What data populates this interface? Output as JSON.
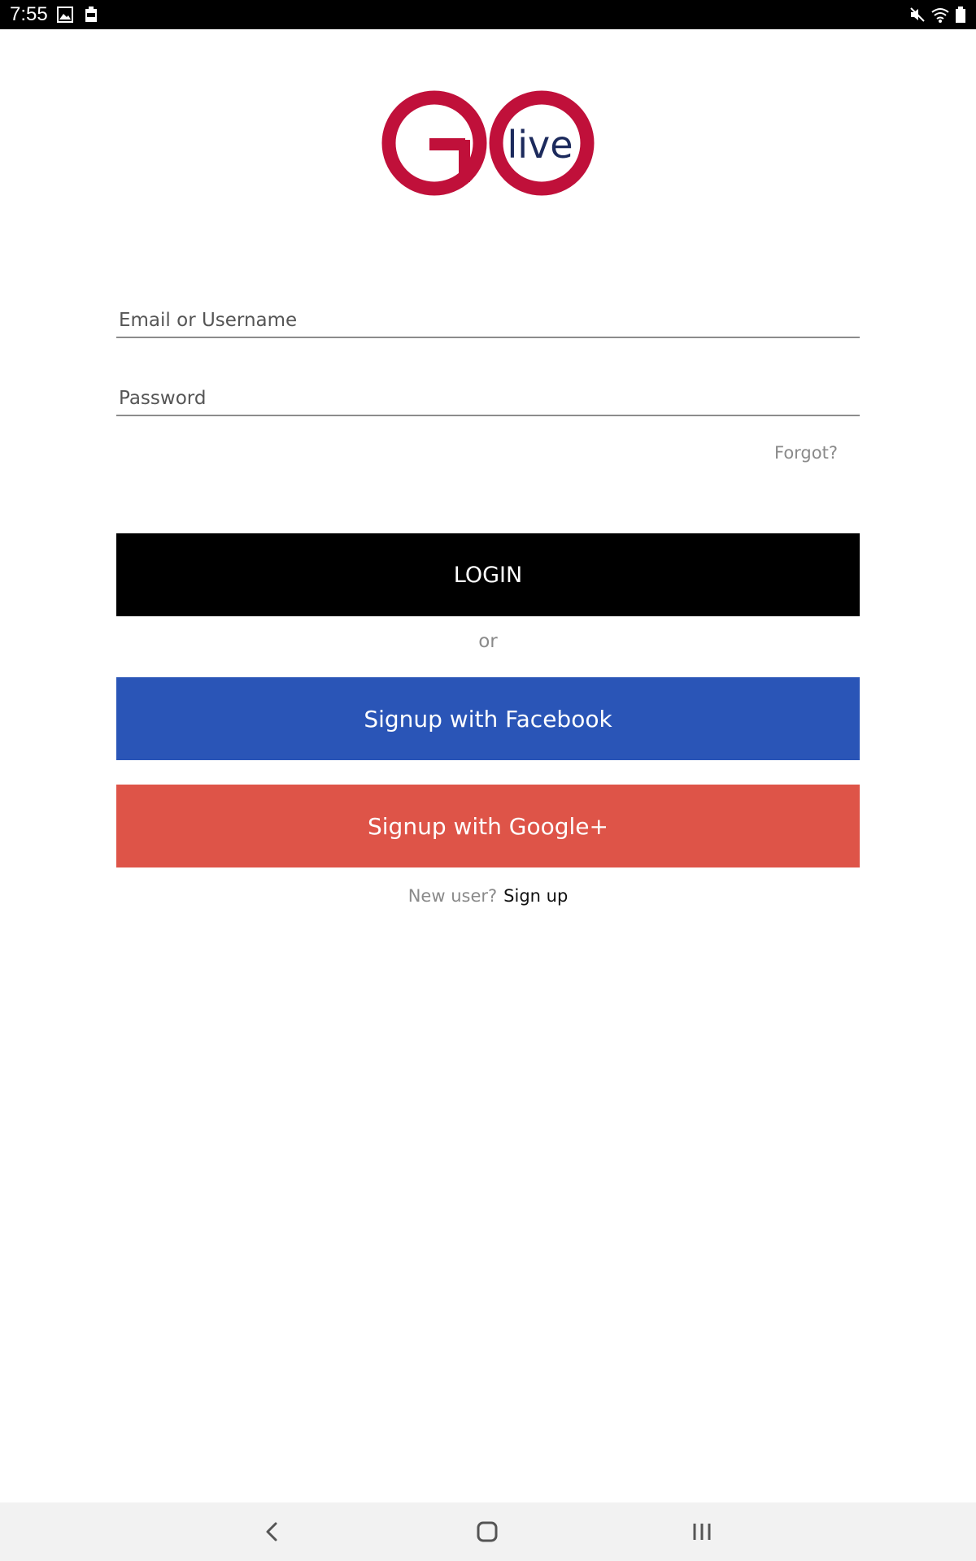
{
  "status_bar": {
    "time": "7:55",
    "left_icons": [
      "image-icon",
      "battery-saver-icon"
    ],
    "right_icons": [
      "mute-icon",
      "wifi-icon",
      "battery-icon"
    ]
  },
  "logo": {
    "text": "GO live",
    "brand_red": "#c0103a",
    "brand_navy": "#1c2a5c"
  },
  "form": {
    "email": {
      "value": "",
      "placeholder": "Email or Username"
    },
    "password": {
      "value": "",
      "placeholder": "Password"
    },
    "forgot_label": "Forgot?"
  },
  "actions": {
    "login_label": "LOGIN",
    "or_label": "or",
    "facebook_label": "Signup with Facebook",
    "google_label": "Signup with Google+",
    "facebook_color": "#2a55b7",
    "google_color": "#de5448"
  },
  "signup": {
    "question": "New user?",
    "link_label": "Sign up"
  },
  "nav_bar": {
    "icons": [
      "back-icon",
      "home-icon",
      "recents-icon"
    ]
  }
}
